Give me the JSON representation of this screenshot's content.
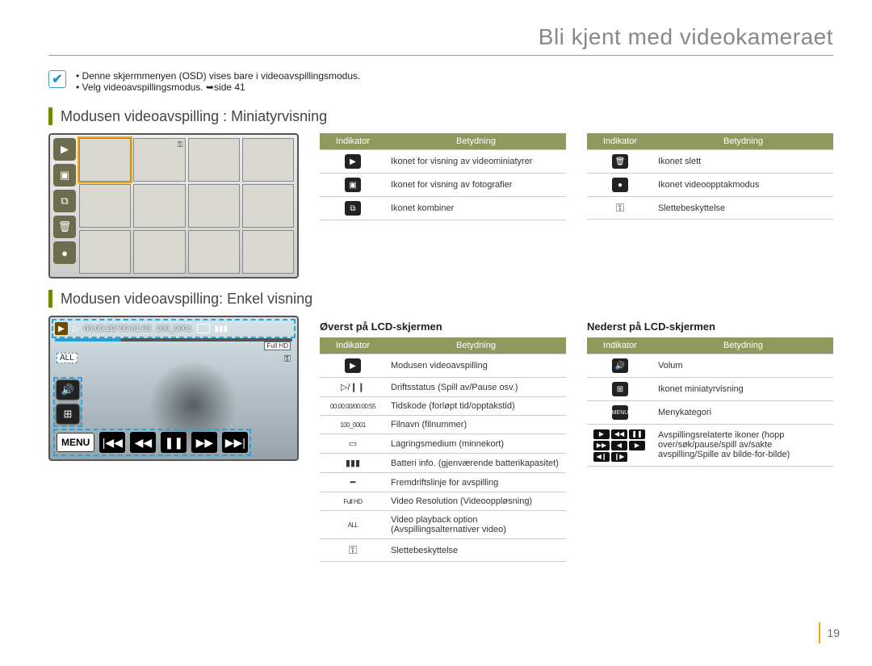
{
  "page": {
    "title": "Bli kjent med videokameraet",
    "number": "19"
  },
  "notes": {
    "items": [
      "Denne skjermmenyen (OSD) vises bare i videoavspillingsmodus.",
      "Velg videoavspillingsmodus. ➥side 41"
    ]
  },
  "section1": {
    "heading": "Modusen videoavspilling : Miniatyrvisning"
  },
  "section2": {
    "heading": "Modusen videoavspilling: Enkel visning"
  },
  "thumb_side_icons": [
    "video-thumb-icon",
    "photo-thumb-icon",
    "combine-icon",
    "trash-icon",
    "record-mode-icon"
  ],
  "table_headers": {
    "indicator": "Indikator",
    "meaning": "Betydning"
  },
  "tables": {
    "miniA": [
      {
        "icon": "video-thumb-icon",
        "glyph": "▶",
        "text": "Ikonet for visning av videominiatyrer"
      },
      {
        "icon": "photo-thumb-icon",
        "glyph": "▣",
        "text": "Ikonet for visning av fotografier"
      },
      {
        "icon": "combine-icon",
        "glyph": "⧉",
        "text": "Ikonet kombiner"
      }
    ],
    "miniB": [
      {
        "icon": "delete-icon",
        "glyph": "🗑",
        "text": "Ikonet slett"
      },
      {
        "icon": "record-mode-icon",
        "glyph": "●",
        "text": "Ikonet videoopptakmodus"
      },
      {
        "icon": "protect-icon",
        "glyph": "⚿",
        "text": "Slettebeskyttelse"
      }
    ],
    "top_lcd_title": "Øverst på LCD-skjermen",
    "top_lcd": [
      {
        "icon": "playback-mode-icon",
        "glyph": "▶",
        "text": "Modusen videoavspilling"
      },
      {
        "icon": "play-pause-icon",
        "glyph": "▷/❙❙",
        "text": "Driftsstatus (Spill av/Pause osv.)"
      },
      {
        "icon": "timecode-icon",
        "glyph": "00:00:00/00:00:55",
        "text": "Tidskode (forløpt tid/opptakstid)"
      },
      {
        "icon": "filename-icon",
        "glyph": "100_0001",
        "text": "Filnavn (filnummer)"
      },
      {
        "icon": "storage-icon",
        "glyph": "▭",
        "text": "Lagringsmedium (minnekort)"
      },
      {
        "icon": "battery-icon",
        "glyph": "▮▮▮",
        "text": "Batteri info. (gjenværende batterikapasitet)"
      },
      {
        "icon": "progress-icon",
        "glyph": "━",
        "text": "Fremdriftslinje for avspilling"
      },
      {
        "icon": "resolution-icon",
        "glyph": "Full HD",
        "text": "Video Resolution (Videooppløsning)"
      },
      {
        "icon": "playback-option-icon",
        "glyph": "ALL",
        "text": "Video playback option (Avspillingsalternativer video)"
      },
      {
        "icon": "protect-icon",
        "glyph": "⚿",
        "text": "Slettebeskyttelse"
      }
    ],
    "bottom_lcd_title": "Nederst på LCD-skjermen",
    "bottom_lcd": [
      {
        "icon": "volume-icon",
        "glyph": "🔊",
        "text": "Volum"
      },
      {
        "icon": "thumbnail-view-icon",
        "glyph": "⊞",
        "text": "Ikonet miniatyrvisning"
      },
      {
        "icon": "menu-icon",
        "glyph": "MENU",
        "text": "Menykategori"
      },
      {
        "icon": "playback-controls-icon",
        "glyph": "ctrl",
        "text": "Avspillingsrelaterte ikoner (hopp over/søk/pause/spill av/sakte avspilling/Spille av bilde-for-bilde)"
      }
    ]
  },
  "singleview": {
    "timecode": "00:00:20/ 00:01:03",
    "filename": "100_0001",
    "all_label": "ALL",
    "hd_label": "Full HD",
    "menu_label": "MENU",
    "controls": [
      "|◀◀",
      "◀◀",
      "❚❚",
      "▶▶",
      "▶▶|"
    ]
  }
}
